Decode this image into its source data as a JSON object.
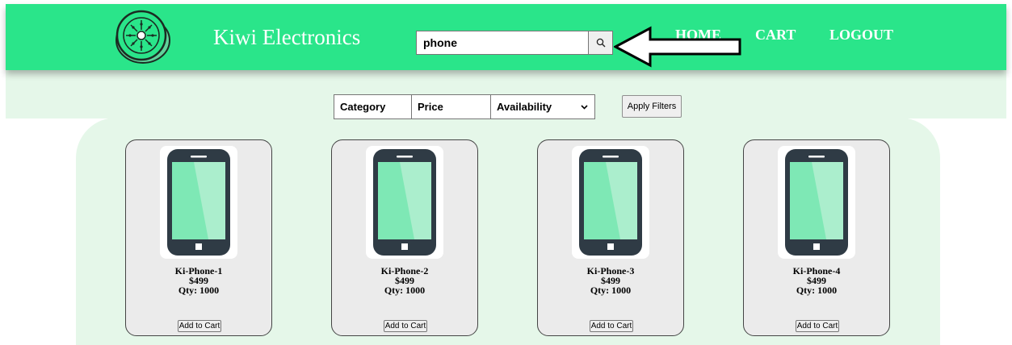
{
  "header": {
    "brand": "Kiwi Electronics",
    "search": {
      "value": "phone",
      "placeholder": ""
    },
    "nav": {
      "home": "HOME",
      "cart": "CART",
      "logout": "LOGOUT"
    }
  },
  "filters": {
    "category_label": "Category",
    "price_label": "Price",
    "availability_label": "Availability",
    "apply_label": "Apply Filters"
  },
  "products": [
    {
      "name": "Ki-Phone-1",
      "price": "$499",
      "qty": "Qty: 1000",
      "button": "Add to Cart"
    },
    {
      "name": "Ki-Phone-2",
      "price": "$499",
      "qty": "Qty: 1000",
      "button": "Add to Cart"
    },
    {
      "name": "Ki-Phone-3",
      "price": "$499",
      "qty": "Qty: 1000",
      "button": "Add to Cart"
    },
    {
      "name": "Ki-Phone-4",
      "price": "$499",
      "qty": "Qty: 1000",
      "button": "Add to Cart"
    }
  ],
  "colors": {
    "header_bg": "#2ae58a",
    "band_bg": "#e5f7e9",
    "card_bg": "#ebebeb",
    "screen_green": "#7ee8b5",
    "phone_body": "#2f3b45"
  },
  "icons": {
    "logo": "kiwi-fruit-icon",
    "search": "magnifier-icon",
    "annotation": "left-arrow-icon",
    "product": "smartphone-icon"
  }
}
